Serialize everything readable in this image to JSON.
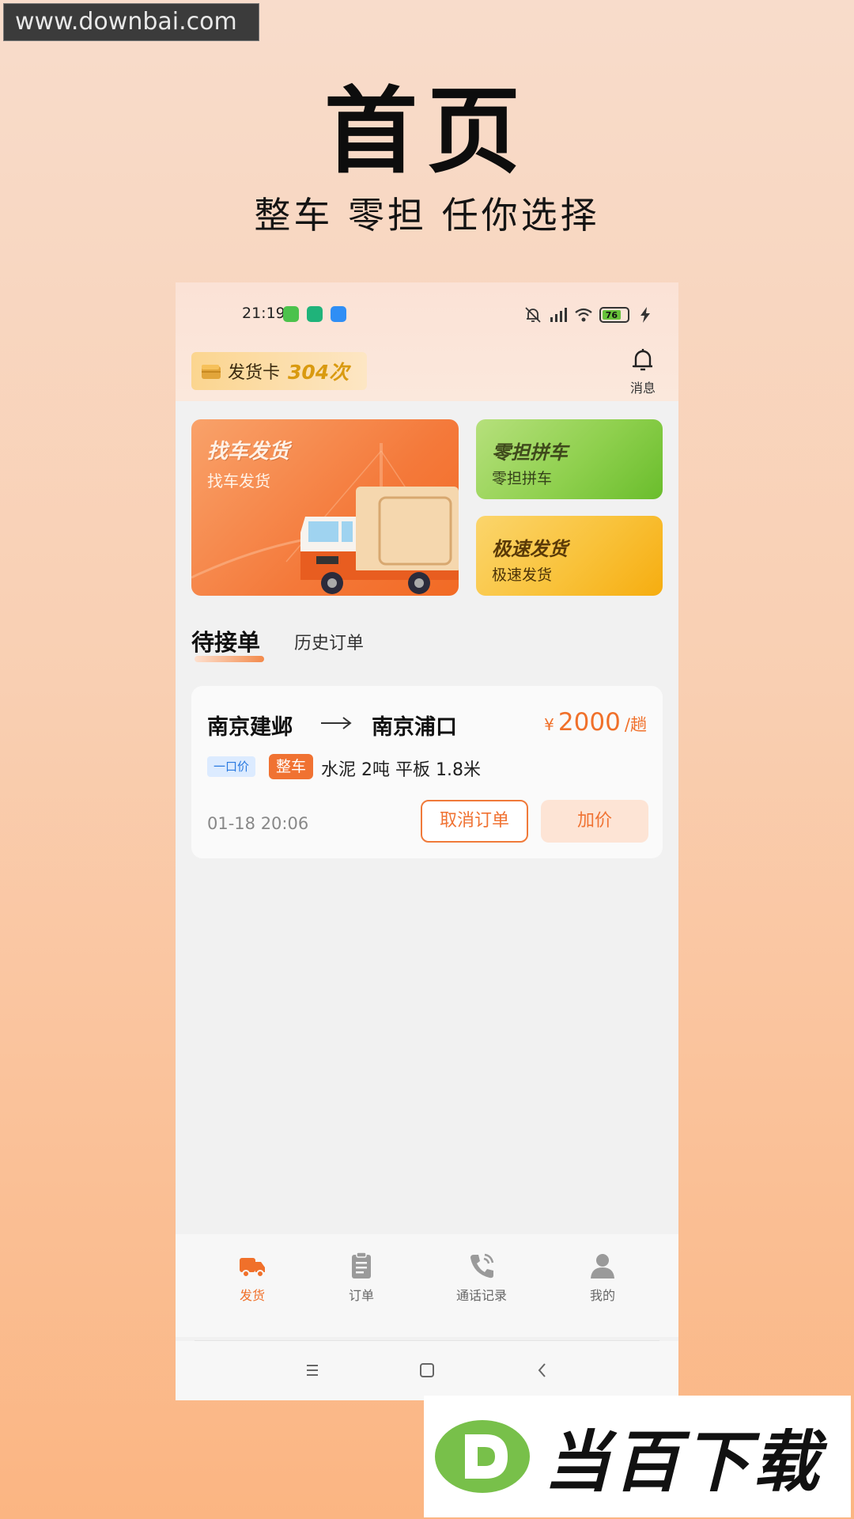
{
  "watermark": {
    "site": "www.downbai.com",
    "brand": "当百下载"
  },
  "hero": {
    "title": "首页",
    "subtitle": "整车 零担 任你选择"
  },
  "status_bar": {
    "time": "21:19",
    "battery": "76"
  },
  "header": {
    "ship_card_label": "发货卡",
    "ship_card_count": "304次",
    "messages_label": "消息"
  },
  "banners": {
    "main": {
      "title": "找车发货",
      "subtitle": "找车发货"
    },
    "ltl": {
      "title": "零担拼车",
      "subtitle": "零担拼车"
    },
    "express": {
      "title": "极速发货",
      "subtitle": "极速发货"
    }
  },
  "tabs": {
    "pending": "待接单",
    "history": "历史订单"
  },
  "order": {
    "from": "南京建邺",
    "to": "南京浦口",
    "price_symbol": "¥",
    "price": "2000",
    "price_unit": "/趟",
    "tag_fixed": "一口价",
    "tag_type": "整车",
    "cargo": "水泥 2吨 平板 1.8米",
    "time": "01-18 20:06",
    "cancel_label": "取消订单",
    "raise_label": "加价"
  },
  "nav": {
    "items": [
      {
        "label": "发货",
        "icon": "truck-icon",
        "active": true
      },
      {
        "label": "订单",
        "icon": "clipboard-icon",
        "active": false
      },
      {
        "label": "通话记录",
        "icon": "phone-icon",
        "active": false
      },
      {
        "label": "我的",
        "icon": "user-icon",
        "active": false
      }
    ]
  },
  "colors": {
    "accent": "#f0702a",
    "green_banner": "#8fd04e",
    "yellow_banner": "#f9c23a",
    "bg_top": "#f8dccb",
    "bg_bottom": "#fbb582"
  }
}
